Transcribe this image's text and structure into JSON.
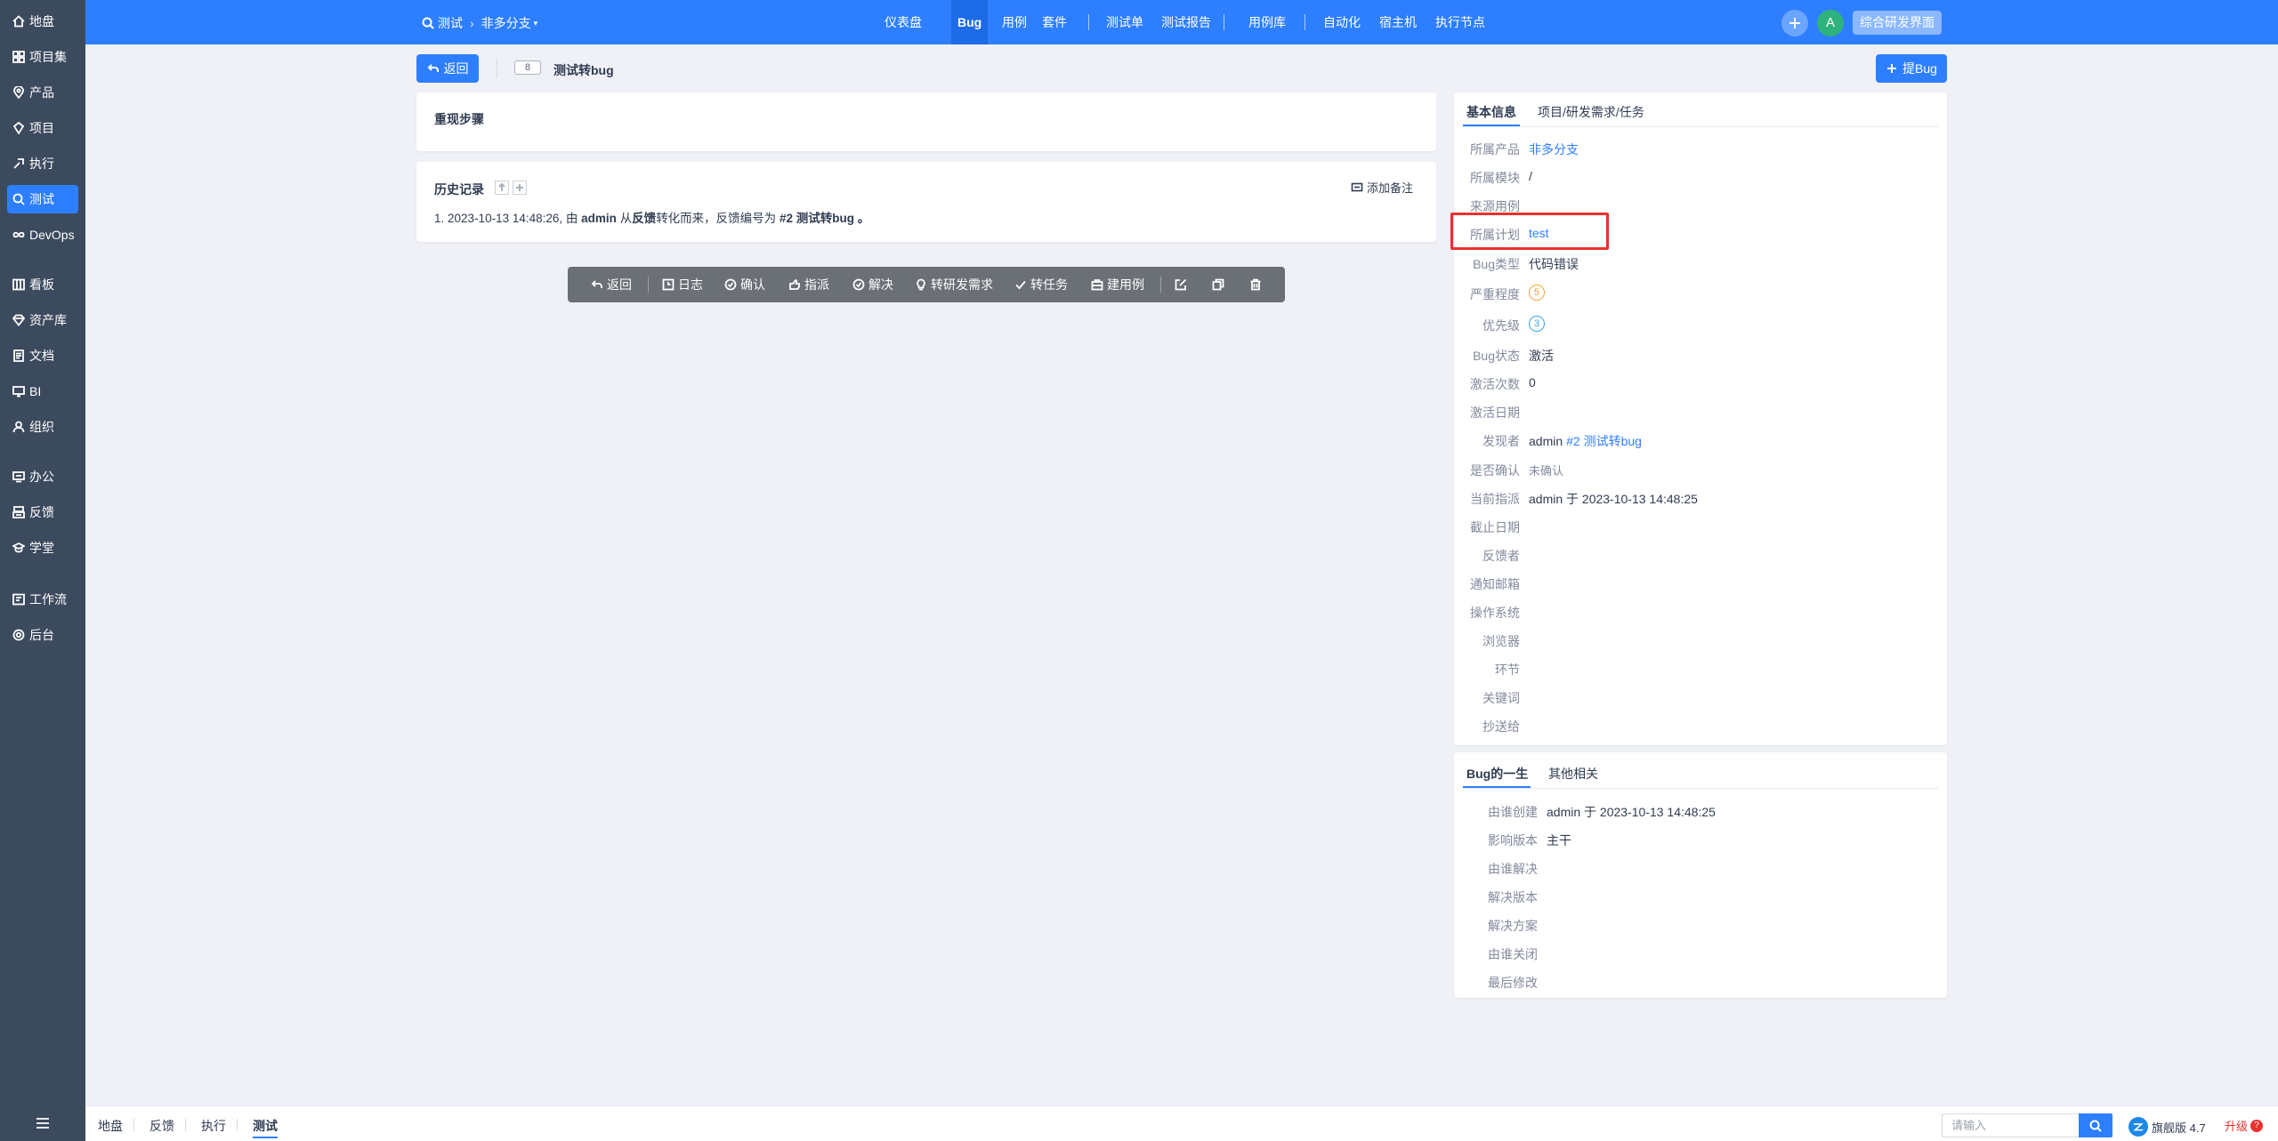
{
  "sidebar": {
    "items": [
      {
        "label": "地盘",
        "icon": "home-icon"
      },
      {
        "label": "项目集",
        "icon": "grid-icon"
      },
      {
        "label": "产品",
        "icon": "location-icon"
      },
      {
        "label": "项目",
        "icon": "project-icon"
      },
      {
        "label": "执行",
        "icon": "run-icon"
      },
      {
        "label": "测试",
        "icon": "search-icon"
      },
      {
        "label": "DevOps",
        "icon": "infinity-icon"
      },
      {
        "label": "看板",
        "icon": "board-icon"
      },
      {
        "label": "资产库",
        "icon": "diamond-icon"
      },
      {
        "label": "文档",
        "icon": "doc-icon"
      },
      {
        "label": "BI",
        "icon": "monitor-icon"
      },
      {
        "label": "组织",
        "icon": "user-icon"
      },
      {
        "label": "办公",
        "icon": "office-icon"
      },
      {
        "label": "反馈",
        "icon": "feedback-icon"
      },
      {
        "label": "学堂",
        "icon": "school-icon"
      },
      {
        "label": "工作流",
        "icon": "workflow-icon"
      },
      {
        "label": "后台",
        "icon": "gear-icon"
      }
    ],
    "active": "测试"
  },
  "topbar": {
    "module": "测试",
    "branch": "非多分支",
    "nav": [
      "仪表盘",
      "Bug",
      "用例",
      "套件",
      "测试单",
      "测试报告",
      "用例库",
      "自动化",
      "宿主机",
      "执行节点"
    ],
    "active_nav": "Bug",
    "avatar_letter": "A",
    "workspace": "综合研发界面"
  },
  "page": {
    "back_label": "返回",
    "bug_id": "8",
    "bug_title": "测试转bug",
    "submit_bug_label": "提Bug"
  },
  "steps": {
    "title": "重现步骤"
  },
  "history": {
    "title": "历史记录",
    "add_remark": "添加备注",
    "entry": {
      "index": "1.",
      "time": "2023-10-13 14:48:26, 由",
      "user": "admin",
      "from": "从",
      "source": "反馈",
      "middle": "转化而来，反馈编号为",
      "ref": "#2 测试转bug",
      "end": "。"
    }
  },
  "actions": [
    "返回",
    "日志",
    "确认",
    "指派",
    "解决",
    "转研发需求",
    "转任务",
    "建用例"
  ],
  "basic_info": {
    "tabs": [
      "基本信息",
      "项目/研发需求/任务"
    ],
    "rows": [
      {
        "label": "所属产品",
        "value": "非多分支"
      },
      {
        "label": "所属模块",
        "value": "/"
      },
      {
        "label": "来源用例",
        "value": ""
      },
      {
        "label": "所属计划",
        "value": "test"
      },
      {
        "label": "Bug类型",
        "value": "代码错误"
      },
      {
        "label": "严重程度",
        "value": "5"
      },
      {
        "label": "优先级",
        "value": "3"
      },
      {
        "label": "Bug状态",
        "value": "激活"
      },
      {
        "label": "激活次数",
        "value": "0"
      },
      {
        "label": "激活日期",
        "value": ""
      },
      {
        "label": "发现者",
        "value": "admin",
        "link": "#2 测试转bug"
      },
      {
        "label": "是否确认",
        "value": "未确认"
      },
      {
        "label": "当前指派",
        "value": "admin 于 2023-10-13 14:48:25"
      },
      {
        "label": "截止日期",
        "value": ""
      },
      {
        "label": "反馈者",
        "value": ""
      },
      {
        "label": "通知邮箱",
        "value": ""
      },
      {
        "label": "操作系统",
        "value": ""
      },
      {
        "label": "浏览器",
        "value": ""
      },
      {
        "label": "环节",
        "value": ""
      },
      {
        "label": "关键词",
        "value": ""
      },
      {
        "label": "抄送给",
        "value": ""
      }
    ]
  },
  "life": {
    "tabs": [
      "Bug的一生",
      "其他相关"
    ],
    "rows": [
      {
        "label": "由谁创建",
        "value": "admin 于 2023-10-13 14:48:25"
      },
      {
        "label": "影响版本",
        "value": "主干"
      },
      {
        "label": "由谁解决",
        "value": ""
      },
      {
        "label": "解决版本",
        "value": ""
      },
      {
        "label": "解决方案",
        "value": ""
      },
      {
        "label": "由谁关闭",
        "value": ""
      },
      {
        "label": "最后修改",
        "value": ""
      }
    ]
  },
  "bottombar": {
    "items": [
      "地盘",
      "反馈",
      "执行",
      "测试"
    ],
    "active": "测试",
    "search_placeholder": "请输入",
    "version": "旗舰版 4.7",
    "upgrade": "升级"
  },
  "colors": {
    "primary": "#2e7fff",
    "sidebar": "#3c4a5e",
    "highlight": "#e9312f"
  }
}
